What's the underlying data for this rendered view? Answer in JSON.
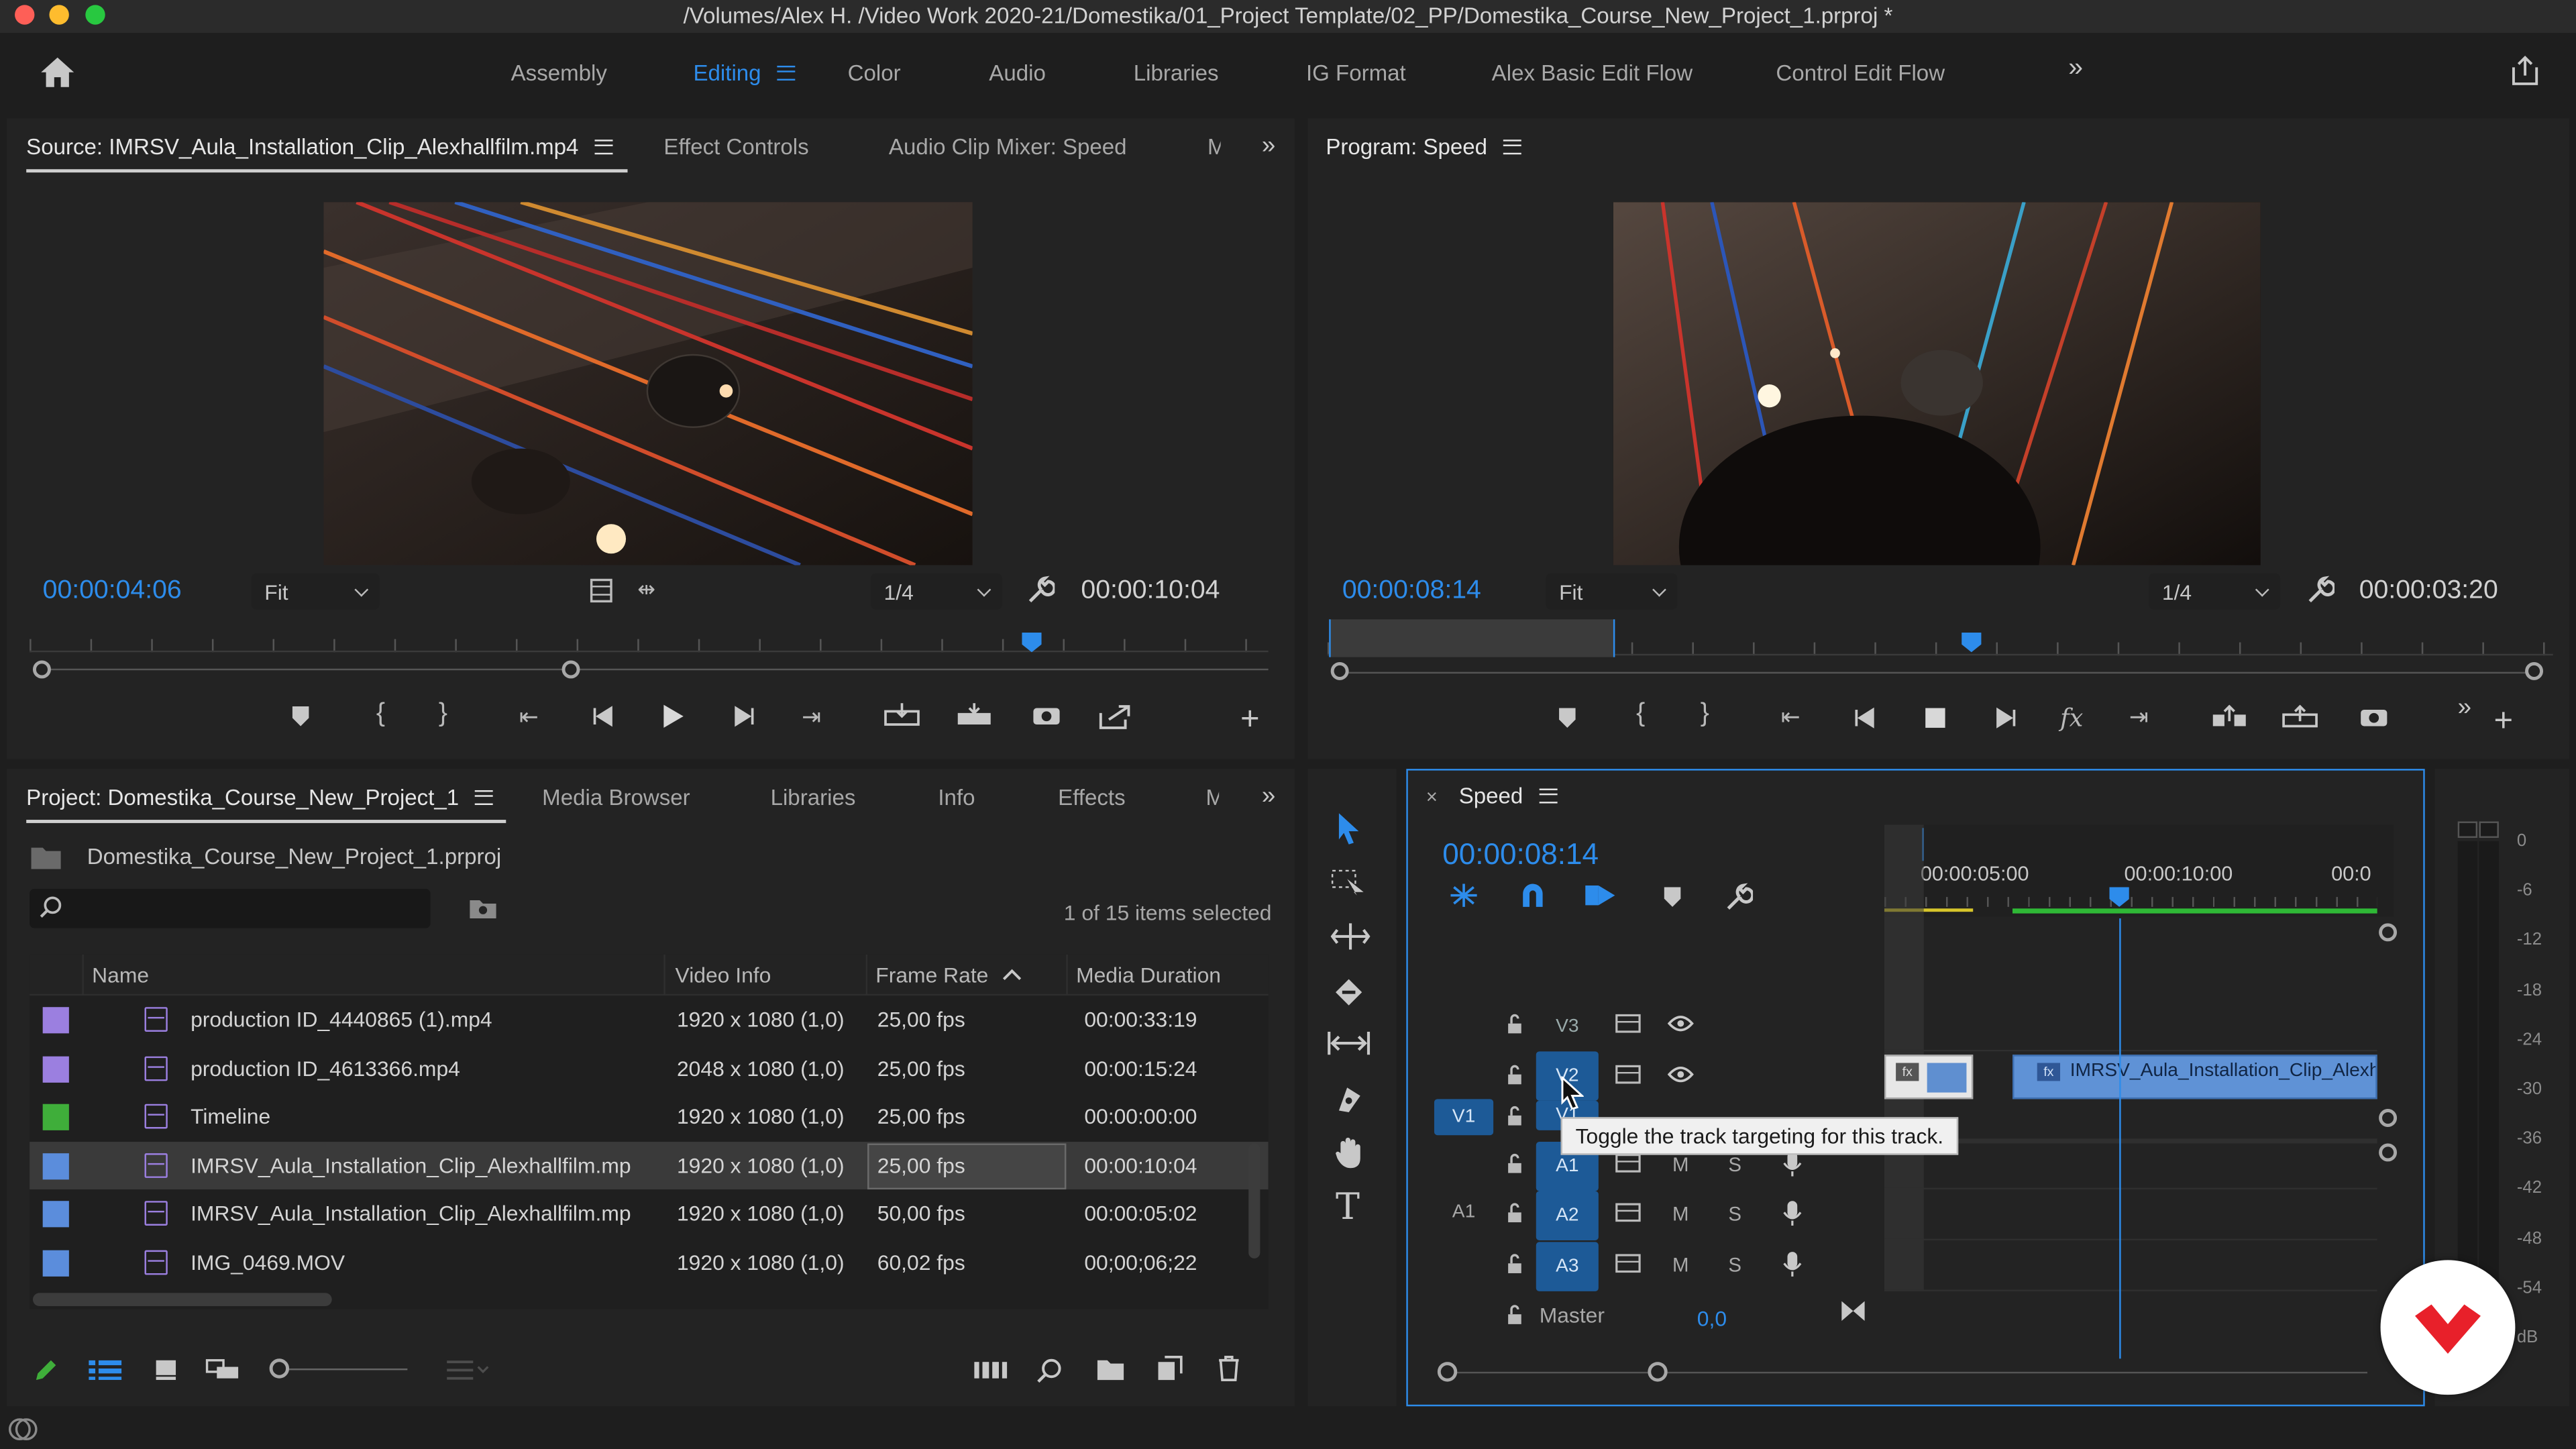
{
  "window": {
    "title": "/Volumes/Alex H. /Video Work 2020-21/Domestika/01_Project Template/02_PP/Domestika_Course_New_Project_1.prproj *"
  },
  "workspaces": [
    {
      "label": "Assembly"
    },
    {
      "label": "Editing",
      "active": true
    },
    {
      "label": "Color"
    },
    {
      "label": "Audio"
    },
    {
      "label": "Libraries"
    },
    {
      "label": "IG Format"
    },
    {
      "label": "Alex Basic Edit Flow"
    },
    {
      "label": "Control Edit Flow"
    }
  ],
  "source_panel": {
    "tabs": [
      "Source: IMRSV_Aula_Installation_Clip_Alexhallfilm.mp4",
      "Effect Controls",
      "Audio Clip Mixer: Speed",
      "M"
    ],
    "timecode": "00:00:04:06",
    "fit": "Fit",
    "resolution": "1/4",
    "duration": "00:00:10:04"
  },
  "program_panel": {
    "tab": "Program: Speed",
    "timecode": "00:00:08:14",
    "fit": "Fit",
    "resolution": "1/4",
    "duration": "00:00:03:20"
  },
  "project_panel": {
    "tabs": [
      "Project: Domestika_Course_New_Project_1",
      "Media Browser",
      "Libraries",
      "Info",
      "Effects",
      "M"
    ],
    "file": "Domestika_Course_New_Project_1.prproj",
    "selection": "1 of 15 items selected",
    "search_placeholder": "",
    "columns": [
      "Name",
      "Video Info",
      "Frame Rate",
      "Media Duration"
    ],
    "rows": [
      {
        "color": "#9b7fe0",
        "icon": "clip-icon",
        "name": "production ID_4440865 (1).mp4",
        "info": "1920 x 1080 (1,0)",
        "rate": "25,00 fps",
        "dur": "00:00:33:19"
      },
      {
        "color": "#9b7fe0",
        "icon": "clip-icon",
        "name": "production ID_4613366.mp4",
        "info": "2048 x 1080 (1,0)",
        "rate": "25,00 fps",
        "dur": "00:00:15:24"
      },
      {
        "color": "#3fae3a",
        "icon": "sequence-icon",
        "name": "Timeline",
        "info": "1920 x 1080 (1,0)",
        "rate": "25,00 fps",
        "dur": "00:00:00:00"
      },
      {
        "color": "#5b8ddc",
        "icon": "av-clip-icon",
        "name": "IMRSV_Aula_Installation_Clip_Alexhallfilm.mp",
        "info": "1920 x 1080 (1,0)",
        "rate": "25,00 fps",
        "dur": "00:00:10:04",
        "selected": true
      },
      {
        "color": "#5b8ddc",
        "icon": "av-clip-icon",
        "name": "IMRSV_Aula_Installation_Clip_Alexhallfilm.mp",
        "info": "1920 x 1080 (1,0)",
        "rate": "50,00 fps",
        "dur": "00:00:05:02"
      },
      {
        "color": "#5b8ddc",
        "icon": "av-clip-icon",
        "name": "IMG_0469.MOV",
        "info": "1920 x 1080 (1,0)",
        "rate": "60,02 fps",
        "dur": "00;00;06;22"
      }
    ]
  },
  "timeline": {
    "title": "Speed",
    "timecode": "00:00:08:14",
    "ruler": [
      "00:00:05:00",
      "00:00:10:00",
      "00:0"
    ],
    "tracks": {
      "v3": "V3",
      "v2": "V2",
      "v1_src": "V1",
      "v1": "V1",
      "a1": "A1",
      "a2_src": "A1",
      "a2": "A2",
      "a3": "A3",
      "m": "M",
      "s": "S",
      "master": "Master",
      "master_val": "0,0"
    },
    "clip_label": "IMRSV_Aula_Installation_Clip_Alexh",
    "tooltip": "Toggle the track targeting for this track."
  },
  "meter": {
    "labels": [
      "0",
      "-6",
      "-12",
      "-18",
      "-24",
      "-30",
      "-36",
      "-42",
      "-48",
      "-54",
      "dB"
    ]
  },
  "colors": {
    "accent_blue": "#2d8ceb",
    "selection_blue": "#1d5a97",
    "brand_red": "#e8202a"
  }
}
